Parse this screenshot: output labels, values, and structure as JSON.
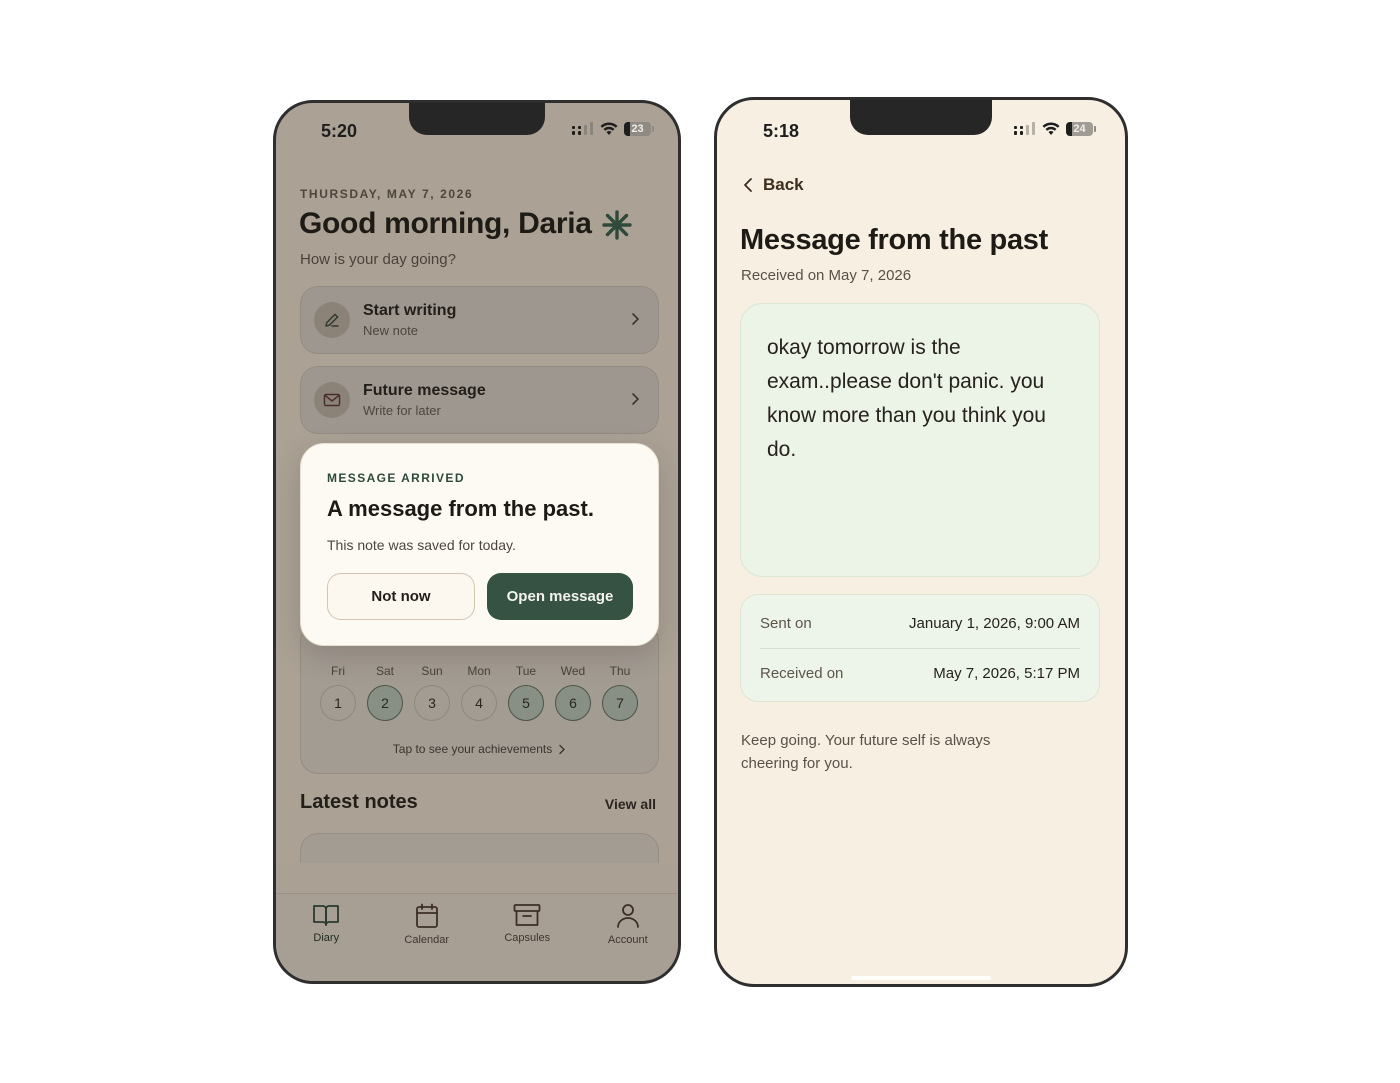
{
  "left_phone": {
    "status_time": "5:20",
    "battery": "23",
    "date_label": "THURSDAY, MAY 7, 2026",
    "greeting": "Good morning, Daria",
    "subgreeting": "How is your day going?",
    "actions": [
      {
        "title": "Start writing",
        "subtitle": "New note",
        "icon": "pencil-icon"
      },
      {
        "title": "Future message",
        "subtitle": "Write for later",
        "icon": "envelope-icon"
      }
    ],
    "week": {
      "days": [
        {
          "name": "Fri",
          "num": "1",
          "done": false
        },
        {
          "name": "Sat",
          "num": "2",
          "done": true
        },
        {
          "name": "Sun",
          "num": "3",
          "done": false
        },
        {
          "name": "Mon",
          "num": "4",
          "done": false
        },
        {
          "name": "Tue",
          "num": "5",
          "done": true
        },
        {
          "name": "Wed",
          "num": "6",
          "done": true
        },
        {
          "name": "Thu",
          "num": "7",
          "done": true
        }
      ],
      "achievements_link": "Tap to see your achievements"
    },
    "latest_notes": {
      "title": "Latest notes",
      "view_all": "View all"
    },
    "modal": {
      "eyebrow": "MESSAGE ARRIVED",
      "title": "A message from the past.",
      "body": "This note was saved for today.",
      "not_now": "Not now",
      "open": "Open message"
    },
    "tabs": [
      {
        "label": "Diary",
        "icon": "book-icon"
      },
      {
        "label": "Calendar",
        "icon": "calendar-icon"
      },
      {
        "label": "Capsules",
        "icon": "archive-box-icon"
      },
      {
        "label": "Account",
        "icon": "person-icon"
      }
    ],
    "colors": {
      "accent": "#355242",
      "overlay_bg": "#aba295"
    }
  },
  "right_phone": {
    "status_time": "5:18",
    "battery": "24",
    "back_label": "Back",
    "title": "Message from the past",
    "received_sub": "Received on May 7, 2026",
    "message": "okay tomorrow is the exam..please don't panic. you know more than you think you do.",
    "meta": {
      "sent_label": "Sent on",
      "sent_value": "January 1, 2026, 9:00 AM",
      "received_label": "Received on",
      "received_value": "May 7, 2026, 5:17 PM"
    },
    "encouragement": "Keep going. Your future self is always cheering for you.",
    "colors": {
      "bg": "#f6efe2",
      "card": "#ecf3e7"
    }
  }
}
